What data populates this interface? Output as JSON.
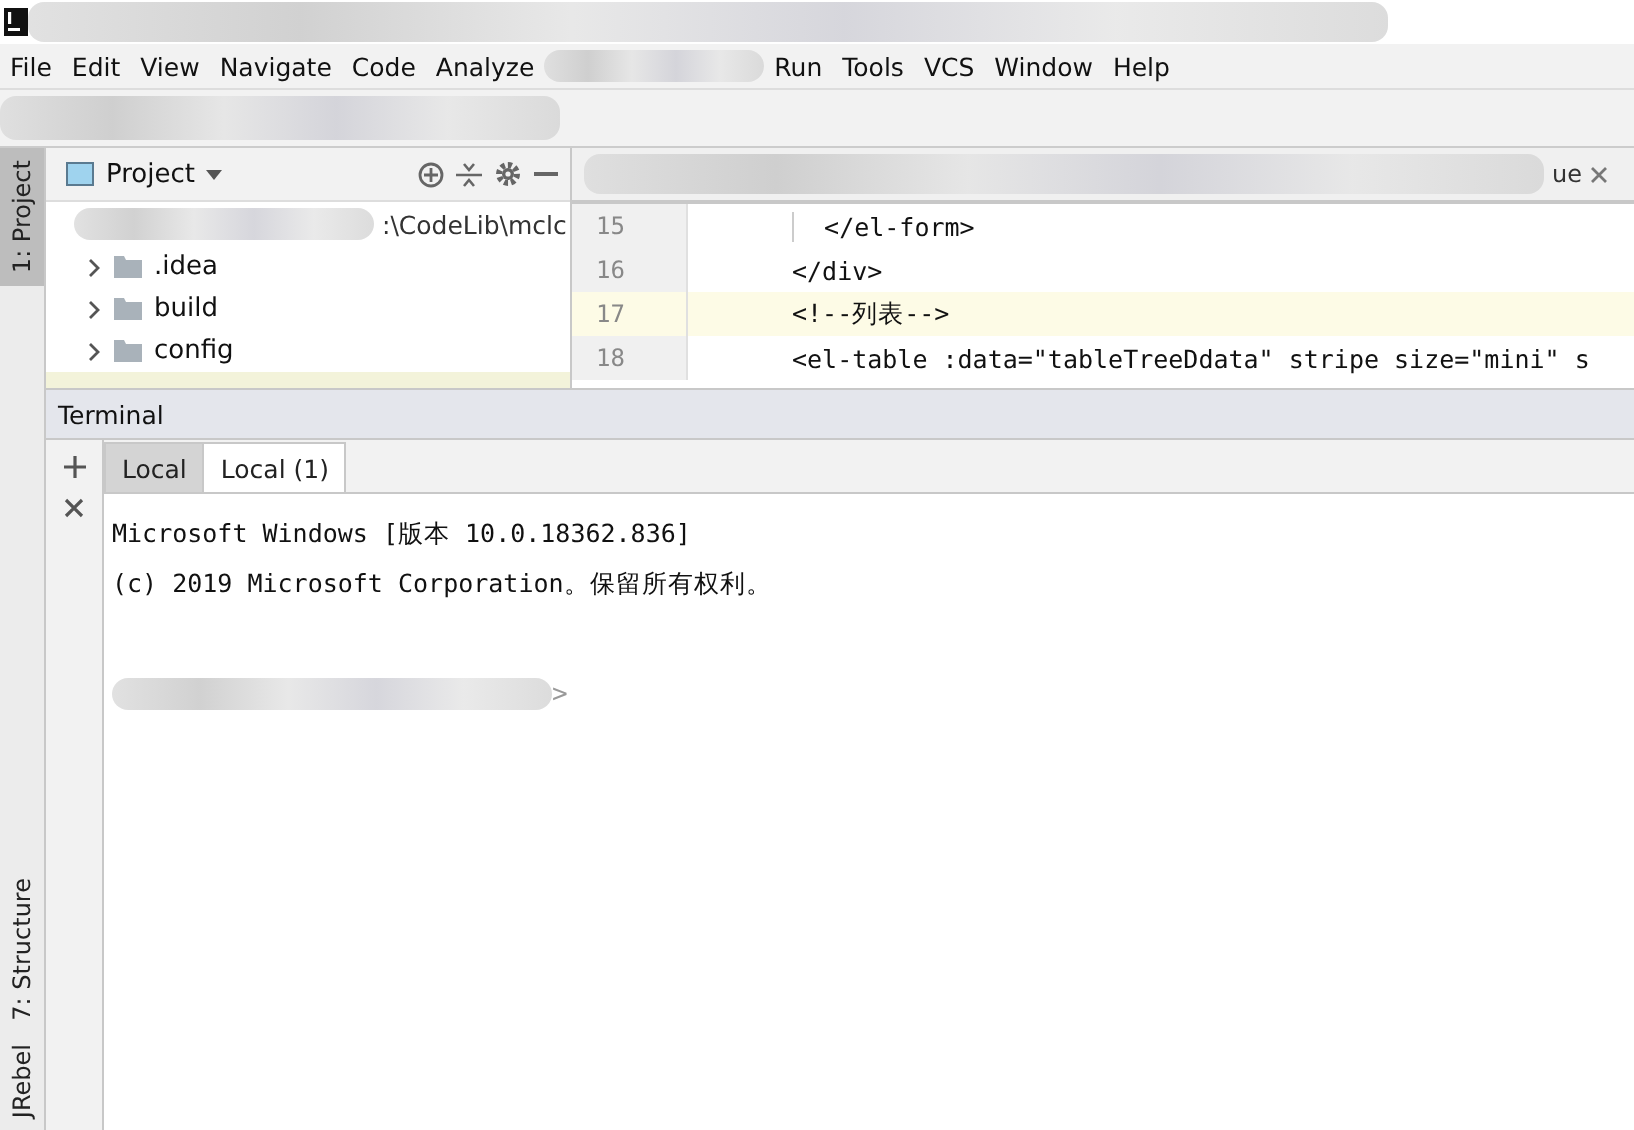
{
  "menu": [
    {
      "label": "File",
      "kind": "item"
    },
    {
      "label": "Edit",
      "kind": "item"
    },
    {
      "label": "View",
      "kind": "item"
    },
    {
      "label": "Navigate",
      "kind": "item"
    },
    {
      "label": "Code",
      "kind": "item"
    },
    {
      "label": "Analyze",
      "kind": "item"
    },
    {
      "kind": "blur"
    },
    {
      "label": "Run",
      "kind": "item"
    },
    {
      "label": "Tools",
      "kind": "item"
    },
    {
      "label": "VCS",
      "kind": "item"
    },
    {
      "label": "Window",
      "kind": "item"
    },
    {
      "label": "Help",
      "kind": "item"
    }
  ],
  "left_stripe": {
    "top": [
      {
        "label": "1: Project",
        "selected": true
      }
    ],
    "bottom": [
      {
        "label": "7: Structure",
        "selected": false
      },
      {
        "label": "JRebel",
        "selected": false
      }
    ]
  },
  "project": {
    "title": "Project",
    "root_path": ":\\CodeLib\\mclc",
    "items": [
      {
        "name": ".idea",
        "expanded": false
      },
      {
        "name": "build",
        "expanded": false
      },
      {
        "name": "config",
        "expanded": false
      }
    ]
  },
  "editor": {
    "tab_fragment": "ue",
    "lines": [
      {
        "number": "15",
        "code": "  </el-form>",
        "current": false,
        "guide": true
      },
      {
        "number": "16",
        "code": "</div>",
        "current": false,
        "guide": false
      },
      {
        "number": "17",
        "code": "<!--列表-->",
        "current": true,
        "guide": false
      },
      {
        "number": "18",
        "code": "<el-table :data=\"tableTreeDdata\" stripe size=\"mini\" s",
        "current": false,
        "guide": false
      }
    ]
  },
  "terminal": {
    "title": "Terminal",
    "tabs": [
      {
        "label": "Local",
        "selected": false
      },
      {
        "label": "Local (1)",
        "selected": true
      }
    ],
    "output": [
      "Microsoft Windows [版本 10.0.18362.836]",
      "(c) 2019 Microsoft Corporation。保留所有权利。"
    ],
    "prompt": ">"
  }
}
